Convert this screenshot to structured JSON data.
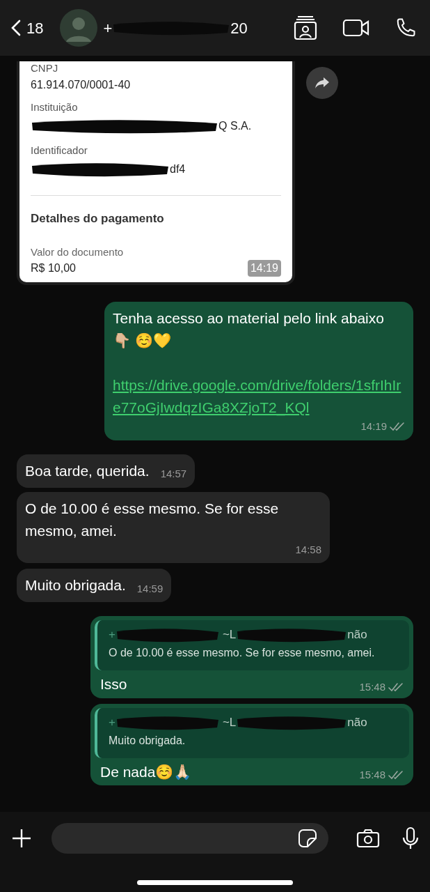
{
  "header": {
    "back_count": "18",
    "contact_prefix": "+",
    "contact_suffix": "20"
  },
  "messages": [
    {
      "kind": "receipt",
      "outgoing": false,
      "fields": [
        {
          "label": "CNPJ",
          "value": "61.914.070/0001-40"
        },
        {
          "label": "Instituição",
          "value": "Q S.A.",
          "redacted": true
        },
        {
          "label": "Identificador",
          "value": "df4",
          "redacted": true
        }
      ],
      "section": "Detalhes do pagamento",
      "amount_label": "Valor do documento",
      "amount": "R$ 10,00",
      "time": "14:19"
    },
    {
      "kind": "text",
      "outgoing": true,
      "text": "Tenha acesso ao material pelo link abaixo 👇🏼 ☺️💛",
      "link": "https://drive.google.com/drive/folders/1sfrIhIre77oGjIwdqzIGa8XZjoT2_KQl",
      "time": "14:19",
      "delivered": true
    },
    {
      "kind": "text",
      "outgoing": false,
      "text": "Boa tarde, querida.",
      "time": "14:57"
    },
    {
      "kind": "text",
      "outgoing": false,
      "text": "O de 10.00 é esse mesmo. Se for esse mesmo,  amei.",
      "time": "14:58"
    },
    {
      "kind": "text",
      "outgoing": false,
      "text": "Muito obrigada.",
      "time": "14:59"
    },
    {
      "kind": "reply",
      "outgoing": true,
      "quote_author": [
        "+",
        "~L",
        "não"
      ],
      "quote_text": "O de 10.00 é esse mesmo. Se for esse mesmo, amei.",
      "text": "Isso",
      "time": "15:48",
      "delivered": true
    },
    {
      "kind": "reply",
      "outgoing": true,
      "quote_author": [
        "+",
        "~L",
        "não"
      ],
      "quote_text": "Muito obrigada.",
      "text": "De nada☺️🙏🏻",
      "time": "15:48",
      "delivered": true
    }
  ]
}
